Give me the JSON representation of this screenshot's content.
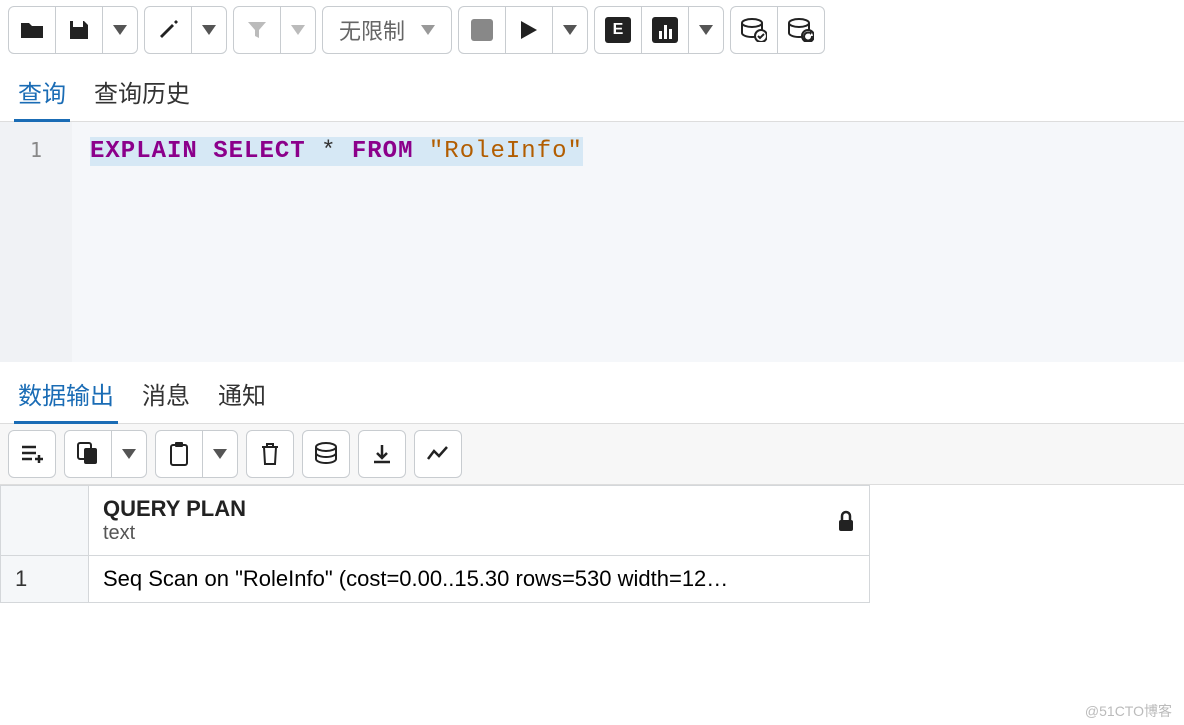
{
  "toolbar": {
    "limit_label": "无限制"
  },
  "tabs": {
    "query": "查询",
    "history": "查询历史"
  },
  "editor": {
    "line_number": "1",
    "sql": {
      "kw1": "EXPLAIN",
      "kw2": "SELECT",
      "star": "*",
      "kw3": "FROM",
      "table": "\"RoleInfo\""
    }
  },
  "result_tabs": {
    "data": "数据输出",
    "messages": "消息",
    "notifications": "通知"
  },
  "result": {
    "columns": [
      {
        "name": "QUERY PLAN",
        "type": "text"
      }
    ],
    "rows": [
      {
        "num": "1",
        "value": "Seq Scan on \"RoleInfo\"  (cost=0.00..15.30 rows=530 width=12…"
      }
    ]
  },
  "watermark": "@51CTO博客"
}
